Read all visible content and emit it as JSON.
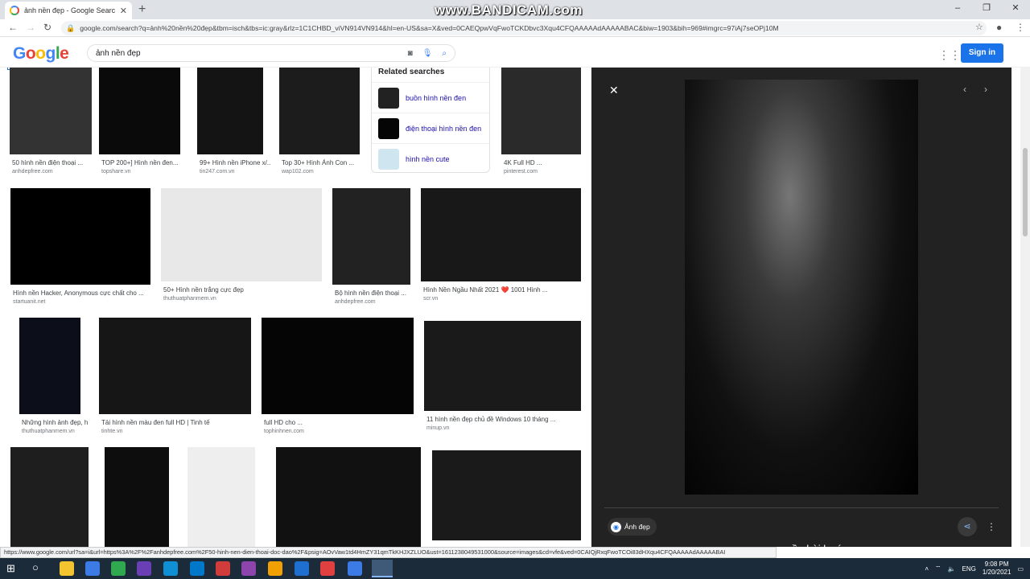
{
  "browser": {
    "tab_title": "ảnh nền đẹp - Google Search",
    "tab_close": "✕",
    "new_tab": "+",
    "watermark": "www.BANDICAM.com",
    "url": "google.com/search?q=ảnh%20nền%20đẹp&tbm=isch&tbs=ic:gray&rlz=1C1CHBD_viVN914VN914&hl=en-US&sa=X&ved=0CAEQpwVqFwoTCKDbvc3Xqu4CFQAAAAAdAAAAABAC&biw=1903&bih=969#imgrc=97iAj7seOPj10M",
    "win_minimize": "–",
    "win_restore": "❐",
    "win_close": "✕"
  },
  "google": {
    "logo": [
      "G",
      "o",
      "o",
      "g",
      "l",
      "e"
    ],
    "logo_colors": [
      "#4285f4",
      "#ea4335",
      "#fbbc05",
      "#4285f4",
      "#34a853",
      "#ea4335"
    ],
    "query": "ảnh nền đẹp",
    "apps_icon": "grid",
    "signin": "Sign in"
  },
  "related": {
    "heading": "Related searches",
    "items": [
      {
        "label": "buồn hình nền đen",
        "thumb": "#222"
      },
      {
        "label": "điện thoại hình nền đen",
        "thumb": "#050505"
      },
      {
        "label": "hình nền cute",
        "thumb": "#cfe6f0"
      }
    ]
  },
  "results": [
    {
      "caption": "50 hình nền điện thoại ...",
      "source": "anhdepfree.com",
      "color": "#333"
    },
    {
      "caption": "TOP 200+] Hình nền đen...",
      "source": "topshare.vn",
      "color": "#0a0a0a"
    },
    {
      "caption": "99+ Hình nền iPhone x/...",
      "source": "tin247.com.vn",
      "color": "#141414"
    },
    {
      "caption": "Top 30+ Hình Ảnh Con ...",
      "source": "wap102.com",
      "color": "#1c1c1c"
    },
    {
      "caption": "4K Full HD ...",
      "source": "pinterest.com",
      "color": "#2a2a2a"
    },
    {
      "caption": "Hình nền Hacker, Anonymous cực chất cho ...",
      "source": "startuanit.net",
      "color": "#000"
    },
    {
      "caption": "50+ Hình nền trắng cực đẹp",
      "source": "thuthuatphanmem.vn",
      "color": "#e8e8e8"
    },
    {
      "caption": "Bộ hình nền điện thoại ...",
      "source": "anhdepfree.com",
      "color": "#222"
    },
    {
      "caption": "Hình Nền Ngầu Nhất 2021 ❤️ 1001 Hình ...",
      "source": "scr.vn",
      "color": "#181818"
    },
    {
      "caption": "Những hình ảnh đẹp, hì...",
      "source": "thuthuatphanmem.vn",
      "color": "#0c0f1a"
    },
    {
      "caption": "Tải hình nền màu đen full HD | Tinh tế",
      "source": "tinhte.vn",
      "color": "#161616"
    },
    {
      "caption": "full HD cho ...",
      "source": "tophinhnen.com",
      "color": "#050505"
    },
    {
      "caption": "11 hình nền đẹp chủ đề Windows 10 tháng ...",
      "source": "minup.vn",
      "color": "#1a1a1a"
    },
    {
      "caption": "",
      "source": "",
      "color": "#1e1e1e"
    },
    {
      "caption": "",
      "source": "",
      "color": "#0d0d0d"
    },
    {
      "caption": "",
      "source": "",
      "color": "#eeeeee"
    },
    {
      "caption": "",
      "source": "",
      "color": "#111"
    },
    {
      "caption": "",
      "source": "",
      "color": "#1a1a1a"
    }
  ],
  "panel": {
    "close": "✕",
    "prev": "‹",
    "next": "›",
    "chip": "Ảnh đẹp",
    "title": "nền hài hước"
  },
  "status_url": "https://www.google.com/url?sa=i&url=https%3A%2F%2Fanhdepfree.com%2F50-hinh-nen-dien-thoai-doc-dao%2F&psig=AOvVaw1td4HmZY31qmTkKHJXZLUO&ust=1611238049531000&source=images&cd=vfe&ved=0CAIQjRxqFwoTCOi83dHXqu4CFQAAAAAdAAAAABAI",
  "taskbar": {
    "lang": "ENG",
    "time": "9:08 PM",
    "date": "1/20/2021",
    "app_colors": [
      "#f4c430",
      "#3c7be5",
      "#2fa84f",
      "#6a3fb5",
      "#0f8fd6",
      "#0077c8",
      "#d03b3b",
      "#8e44ad",
      "#f0a000",
      "#1f6fd0",
      "#e04040",
      "#3c7be5"
    ]
  }
}
